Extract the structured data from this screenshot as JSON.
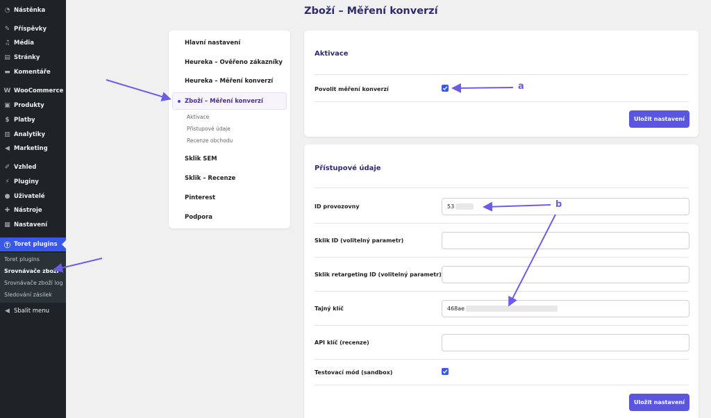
{
  "admin_menu": {
    "items": [
      {
        "label": "Nástěnka",
        "icon": "dashboard-icon"
      },
      {
        "label": "Příspěvky",
        "icon": "pin-icon"
      },
      {
        "label": "Média",
        "icon": "media-icon"
      },
      {
        "label": "Stránky",
        "icon": "pages-icon"
      },
      {
        "label": "Komentáře",
        "icon": "comments-icon"
      },
      {
        "label": "WooCommerce",
        "icon": "woocommerce-icon"
      },
      {
        "label": "Produkty",
        "icon": "products-icon"
      },
      {
        "label": "Platby",
        "icon": "payments-icon"
      },
      {
        "label": "Analytiky",
        "icon": "analytics-icon"
      },
      {
        "label": "Marketing",
        "icon": "marketing-icon"
      },
      {
        "label": "Vzhled",
        "icon": "appearance-icon"
      },
      {
        "label": "Pluginy",
        "icon": "plugins-icon"
      },
      {
        "label": "Uživatelé",
        "icon": "users-icon"
      },
      {
        "label": "Nástroje",
        "icon": "tools-icon"
      },
      {
        "label": "Nastavení",
        "icon": "settings-icon"
      },
      {
        "label": "Toret plugins",
        "icon": "toret-icon"
      }
    ],
    "submenu": [
      "Toret plugins",
      "Srovnávače zboží",
      "Srovnávače zboží log",
      "Sledování zásilek"
    ],
    "collapse": "Sbalit menu"
  },
  "page_title": "Zboží – Měření konverzí",
  "plugin_nav": {
    "items": [
      "Hlavní nastavení",
      "Heureka – Ověřeno zákazníky",
      "Heureka – Měření konverzí",
      "Zboží – Měření konverzí",
      "Sklik SEM",
      "Sklik – Recenze",
      "Pinterest",
      "Podpora"
    ],
    "subitems": [
      "Aktivace",
      "Přístupové údaje",
      "Recenze obchodu"
    ]
  },
  "activation": {
    "title": "Aktivace",
    "enable_label": "Povolit měření konverzí",
    "enabled": true,
    "save": "Uložit nastavení"
  },
  "access": {
    "title": "Přístupové údaje",
    "shop_id_label": "ID provozovny",
    "shop_id_value": "53",
    "sklik_id_label": "Sklik ID (volitelný parametr)",
    "sklik_retarget_label": "Sklik retargeting ID (volitelný parametr)",
    "secret_key_label": "Tajný klíč",
    "secret_key_value": "468ae",
    "api_key_label": "API klíč (recenze)",
    "sandbox_label": "Testovací mód (sandbox)",
    "sandbox": true,
    "save": "Uložit nastavení"
  },
  "annotations": {
    "a": "a",
    "b": "b",
    "color": "#6b5ce7"
  }
}
